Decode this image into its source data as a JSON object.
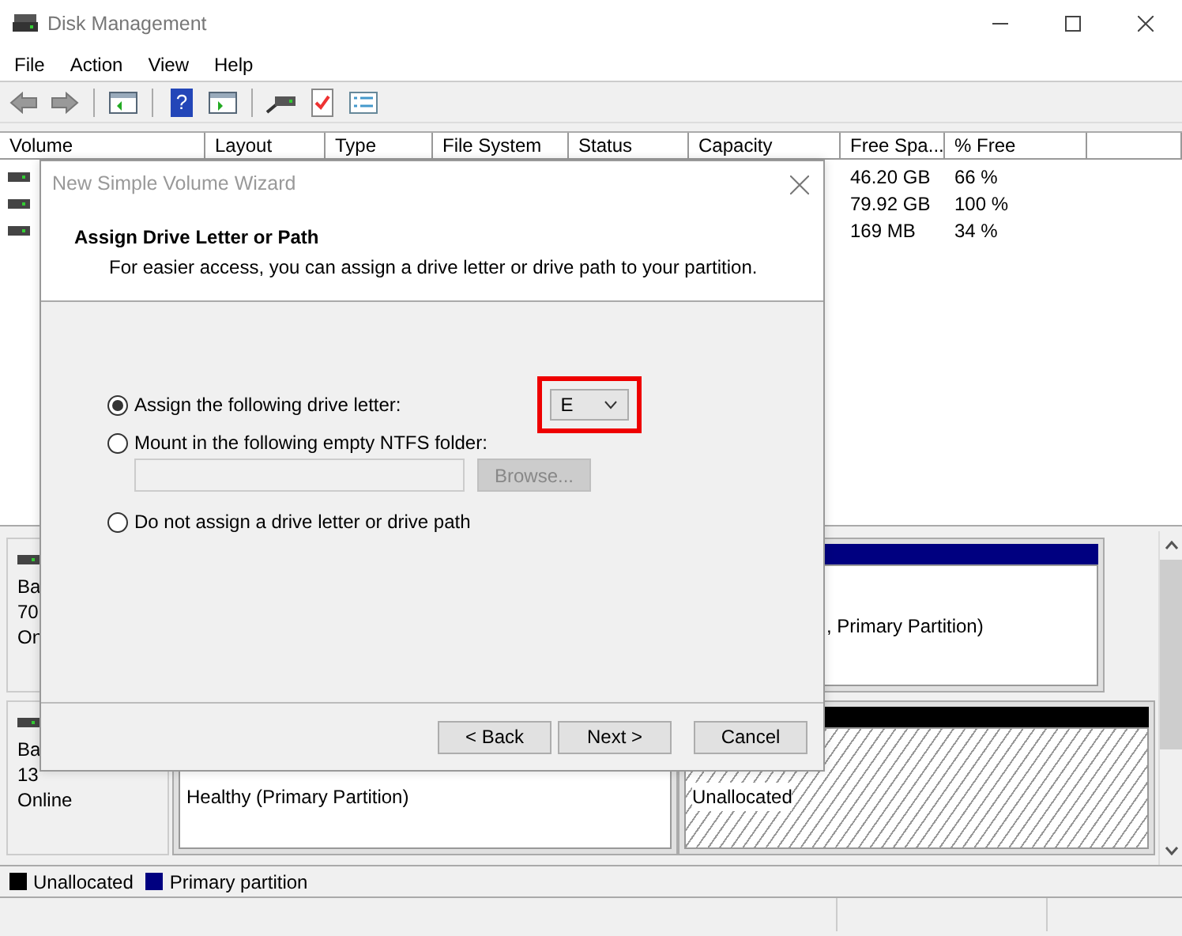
{
  "window": {
    "title": "Disk Management"
  },
  "menu": [
    "File",
    "Action",
    "View",
    "Help"
  ],
  "toolbar": {
    "help_glyph": "?"
  },
  "volume_list": {
    "columns": [
      "Volume",
      "Layout",
      "Type",
      "File System",
      "Status",
      "Capacity",
      "Free Spa...",
      "% Free"
    ],
    "rows": [
      {
        "free_space": "46.20 GB",
        "percent_free": "66 %"
      },
      {
        "free_space": "79.92 GB",
        "percent_free": "100 %"
      },
      {
        "free_space": "169 MB",
        "percent_free": "34 %"
      }
    ]
  },
  "disks": [
    {
      "label_lines": [
        "Ba",
        "70",
        "On"
      ],
      "partitions": [
        {
          "kind": "primary",
          "text": ", Primary Partition)"
        }
      ]
    },
    {
      "label_lines": [
        "Ba",
        "13",
        "Online"
      ],
      "partitions": [
        {
          "kind": "primary",
          "text": "Healthy (Primary Partition)"
        },
        {
          "kind": "unallocated",
          "text": "Unallocated"
        }
      ]
    }
  ],
  "legend": [
    {
      "kind": "unallocated",
      "label": "Unallocated",
      "color": "#000000"
    },
    {
      "kind": "primary",
      "label": "Primary partition",
      "color": "#000080"
    }
  ],
  "dialog": {
    "title": "New Simple Volume Wizard",
    "heading": "Assign Drive Letter or Path",
    "subtitle": "For easier access, you can assign a drive letter or drive path to your partition.",
    "options": [
      {
        "label": "Assign the following drive letter:",
        "selected": true
      },
      {
        "label": "Mount in the following empty NTFS folder:",
        "selected": false
      },
      {
        "label": "Do not assign a drive letter or drive path",
        "selected": false
      }
    ],
    "drive_letter": "E",
    "folder_field": {
      "disabled": true
    },
    "browse_button": {
      "label": "Browse...",
      "disabled": true
    },
    "buttons": [
      "< Back",
      "Next >",
      "Cancel"
    ]
  }
}
